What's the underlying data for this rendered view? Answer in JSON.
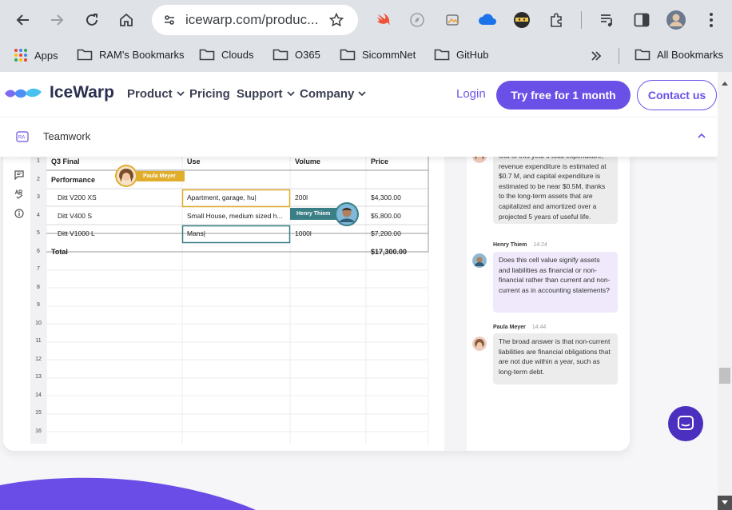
{
  "browser": {
    "url": "icewarp.com/produc...",
    "bookmarks": [
      "Apps",
      "RAM's Bookmarks",
      "Clouds",
      "O365",
      "SicommNet",
      "GitHub"
    ],
    "all_bookmarks": "All Bookmarks"
  },
  "site": {
    "brand": "IceWarp",
    "nav": [
      "Product",
      "Pricing",
      "Support",
      "Company"
    ],
    "login": "Login",
    "try_free": "Try free for 1 month",
    "contact": "Contact us",
    "submenu": "Teamwork"
  },
  "sheet": {
    "headers": [
      "Q3 Final",
      "Use",
      "Volume",
      "Price"
    ],
    "rows": [
      {
        "num": "1"
      },
      {
        "num": "2",
        "a": "Performance"
      },
      {
        "num": "3",
        "a": "Ditt V200 XS",
        "b": "Apartment, garage, hu|",
        "c": "200l",
        "d": "$4,300.00"
      },
      {
        "num": "4",
        "a": "Ditt V400 S",
        "b": "Small House, medium sized h...",
        "c": "",
        "d": "$5,800.00"
      },
      {
        "num": "5",
        "a": "Ditt V1000 L",
        "b": "Mans|",
        "c": "1000l",
        "d": "$7,200.00"
      },
      {
        "num": "6",
        "a": "Total",
        "d": "$17,300.00"
      },
      {
        "num": "7"
      },
      {
        "num": "8"
      },
      {
        "num": "9"
      },
      {
        "num": "10"
      },
      {
        "num": "11"
      },
      {
        "num": "12"
      },
      {
        "num": "13"
      },
      {
        "num": "14"
      },
      {
        "num": "15"
      },
      {
        "num": "16"
      }
    ],
    "badges": {
      "paula": "Paula Meyer",
      "henry": "Henry Thiem"
    }
  },
  "chat": {
    "messages": [
      {
        "author": "",
        "time": "",
        "text": "Out of this year's total expenditure, revenue expenditure is estimated at $0.7 M, and capital expenditure is estimated to be near $0.5M, thanks to the long-term assets that are capitalized and amortized over a projected 5 years of useful life."
      },
      {
        "author": "Henry Thiem",
        "time": "14:24",
        "text": "Does this cell value signify assets and liabilities as financial or non-financial rather than current and non-current as in accounting statements?"
      },
      {
        "author": "Paula Meyer",
        "time": "14:44",
        "text": "The broad answer is that non-current liabilities are financial obligations that are not due within a year, such as long-term debt."
      }
    ]
  },
  "colors": {
    "accent": "#6a50e6",
    "paula": "#e0ad2c",
    "henry": "#3a7f86"
  }
}
